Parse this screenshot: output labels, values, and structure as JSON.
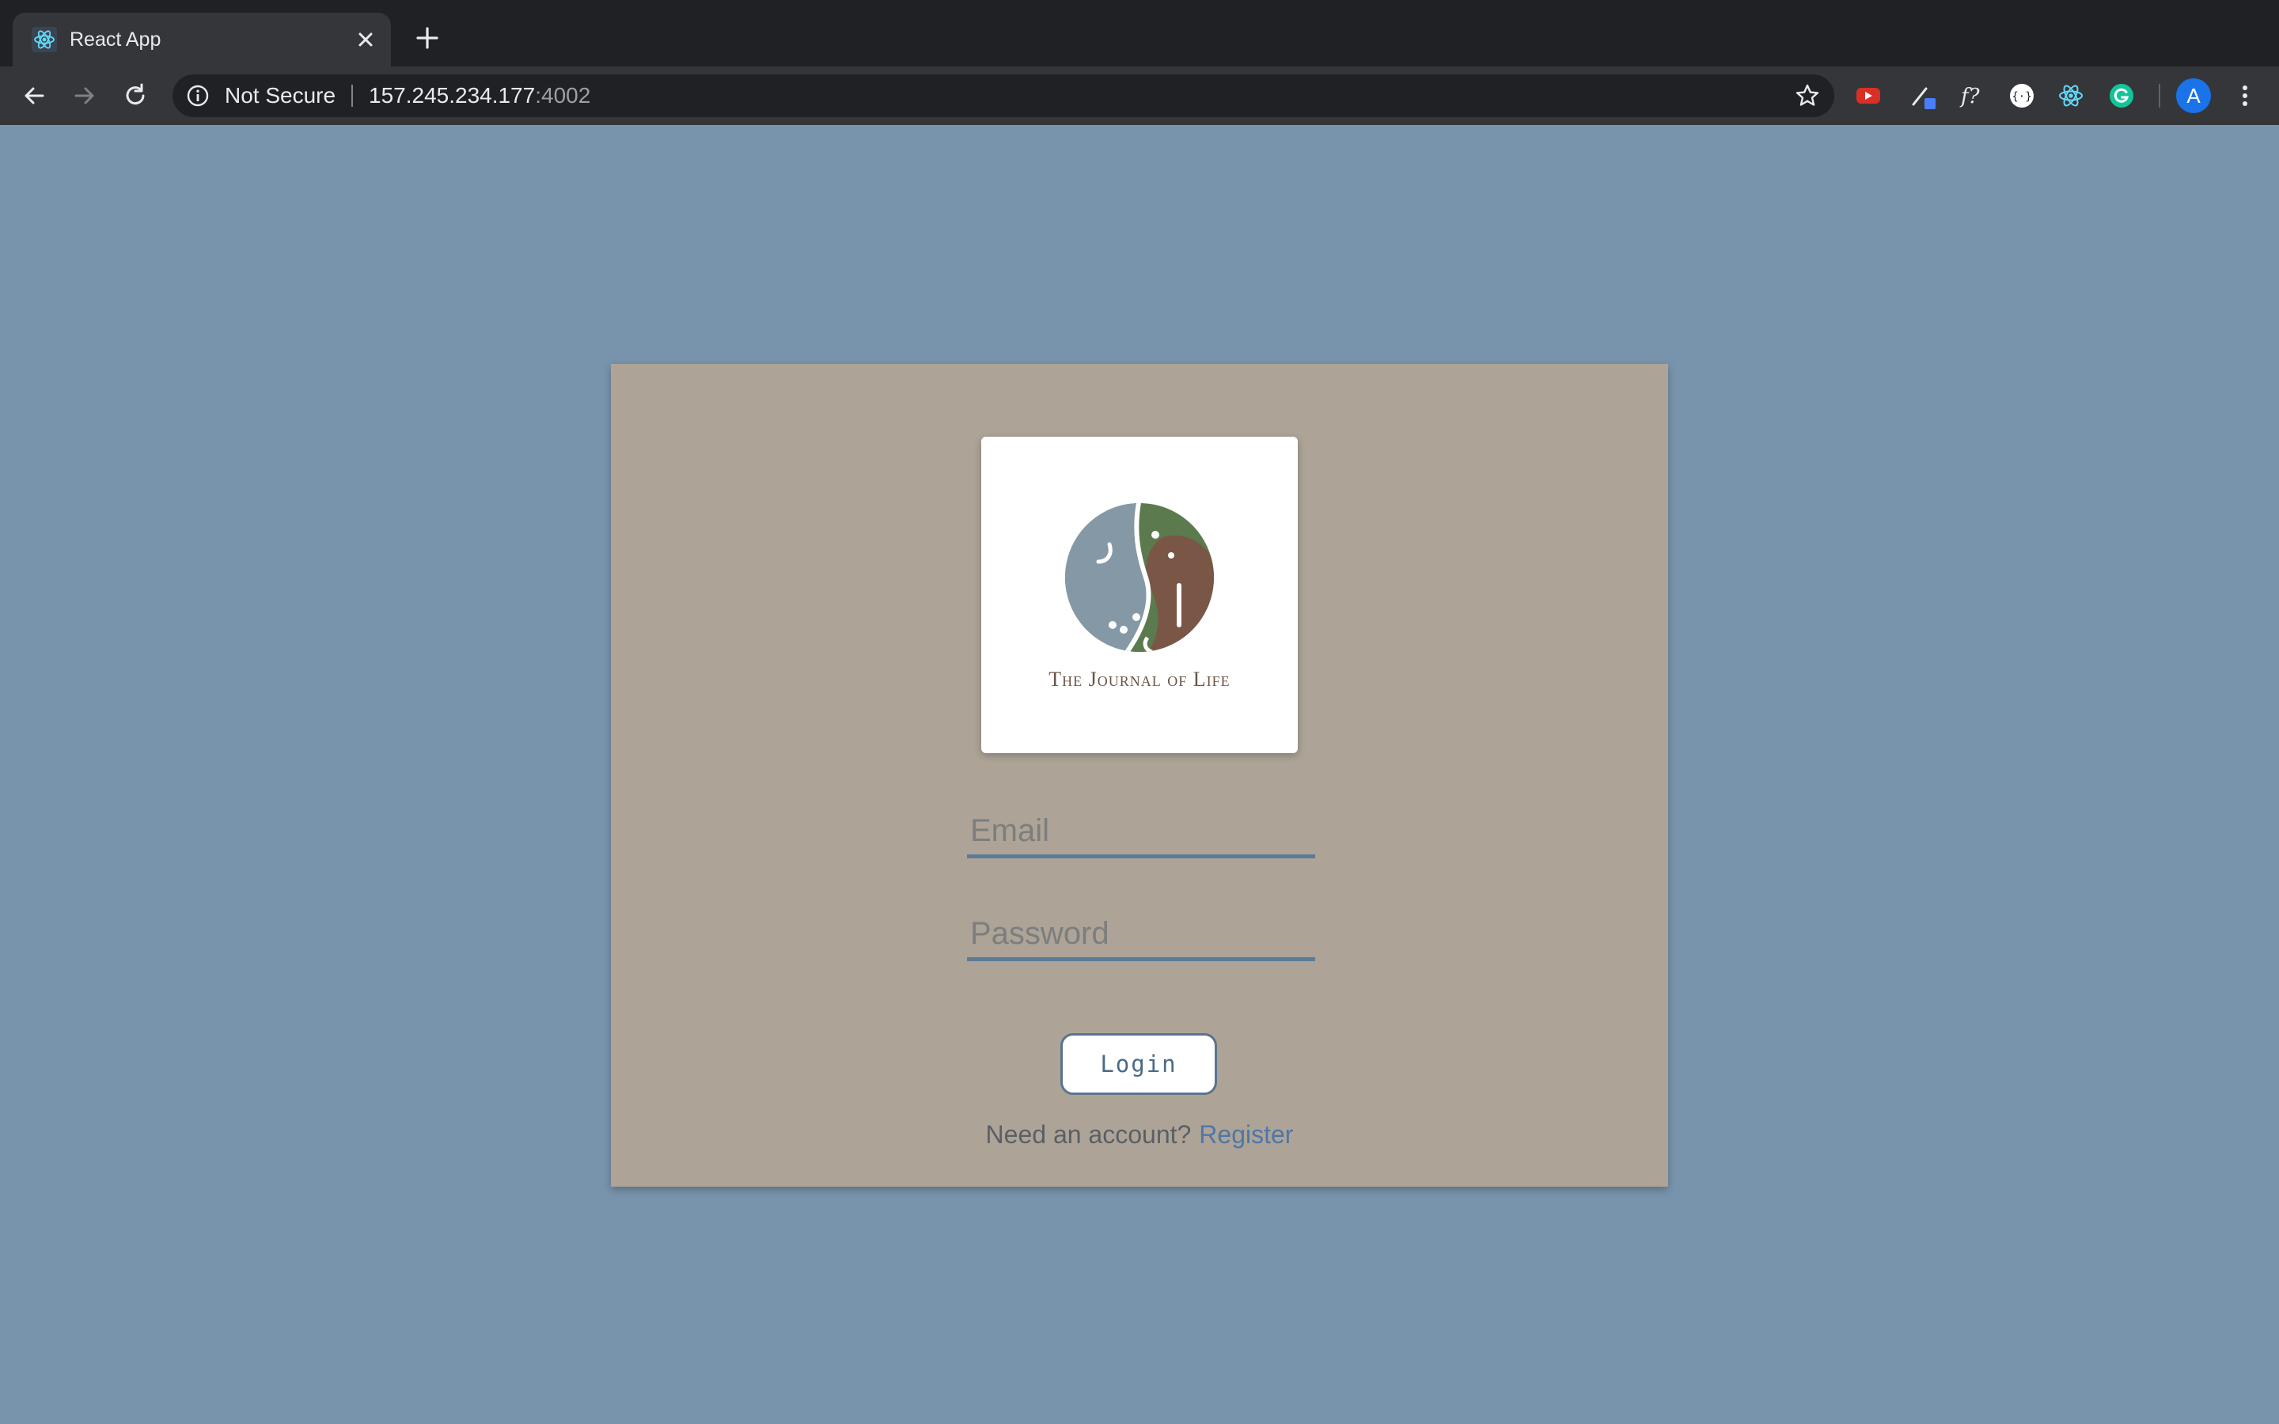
{
  "browser": {
    "tab": {
      "title": "React App",
      "favicon": "react-icon"
    },
    "new_tab_icon": "plus-icon",
    "omnibox": {
      "security_label": "Not Secure",
      "url_host": "157.245.234.177",
      "url_port": ":4002"
    },
    "extensions": [
      "youtube-icon",
      "color-picker-icon",
      "font-icon",
      "code-braces-icon",
      "react-devtools-icon",
      "grammarly-icon"
    ],
    "profile_initial": "A"
  },
  "login": {
    "logo_text": "The Journal of Life",
    "email_placeholder": "Email",
    "password_placeholder": "Password",
    "login_label": "Login",
    "register_prompt": "Need an account?",
    "register_link": "Register"
  },
  "colors": {
    "page_bg": "#7894ac",
    "card_bg": "#ada497",
    "accent": "#5c7b98"
  }
}
